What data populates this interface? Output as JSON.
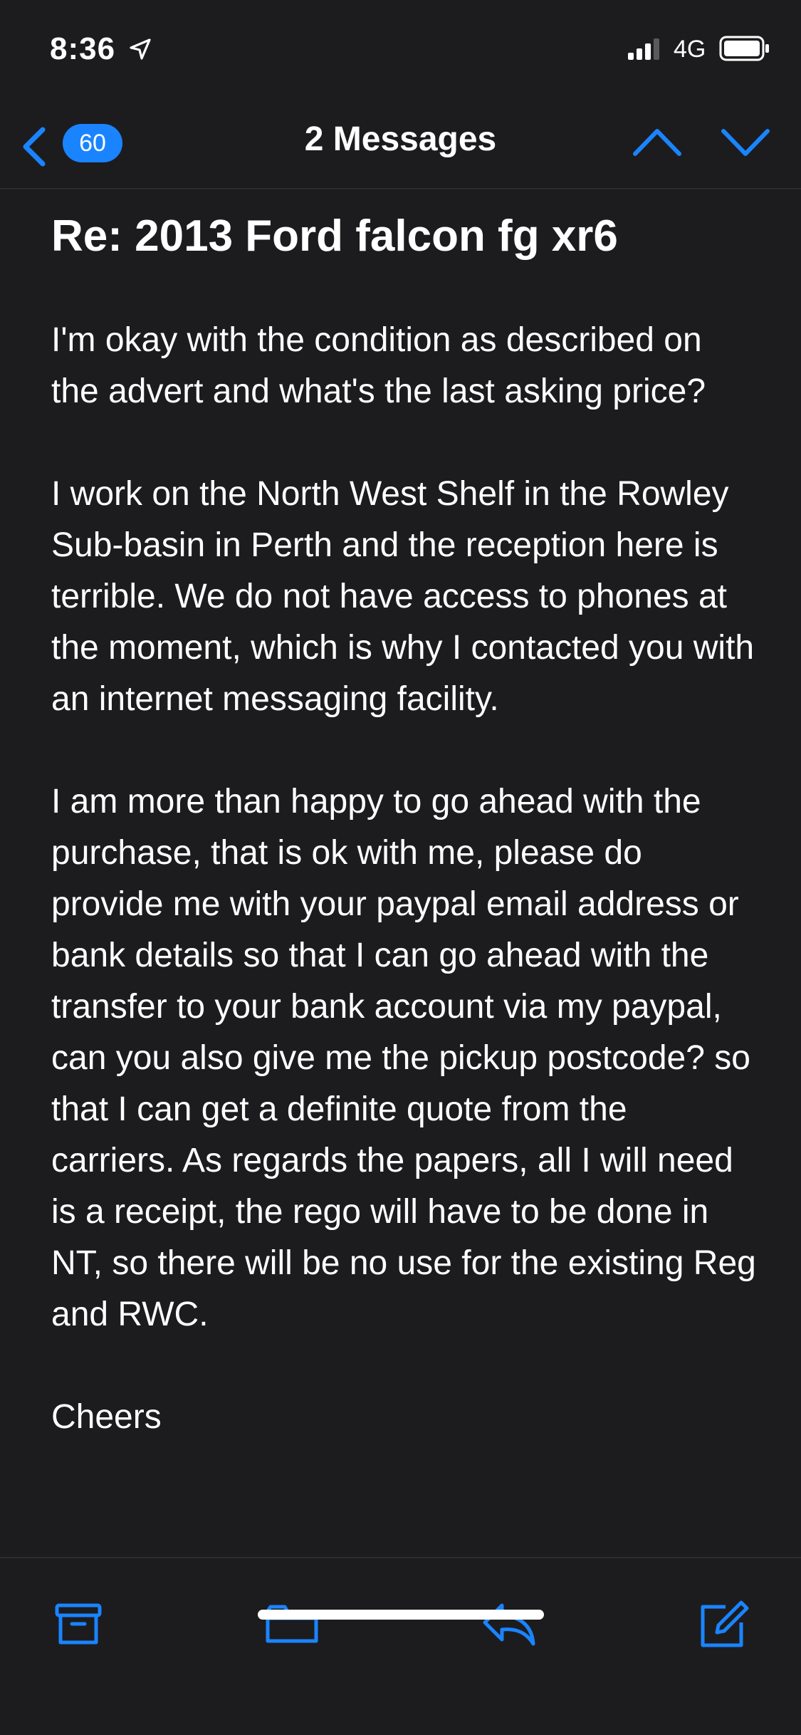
{
  "status_bar": {
    "time": "8:36",
    "network": "4G",
    "icons": [
      "location-arrow-icon",
      "signal-bars-icon",
      "battery-icon"
    ]
  },
  "nav": {
    "back_count": "60",
    "title": "2 Messages",
    "icons": [
      "back-chevron-icon",
      "chevron-up-icon",
      "chevron-down-icon"
    ]
  },
  "message": {
    "subject": "Re: 2013 Ford falcon fg xr6",
    "paragraphs": [
      "I'm okay with the condition as described on the advert and what's the last asking price?",
      "I work on the North West Shelf in the Rowley Sub-basin in Perth and the reception here is terrible. We do not have access to phones at the moment, which is why I contacted you with an internet messaging facility.",
      "I am more than happy to go ahead with the purchase, that is ok with me, please do provide me with your paypal email address or bank details so that I can go ahead with the transfer to your bank account via my paypal, can you also give me the pickup postcode? so that I can get a definite quote from the carriers. As regards the papers, all I will need is a receipt, the rego will have to be done in NT, so there will be no use for the existing Reg and RWC.",
      "Cheers"
    ]
  },
  "toolbar": {
    "icons": [
      "archive-icon",
      "folder-icon",
      "reply-icon",
      "compose-icon"
    ]
  },
  "colors": {
    "background": "#1c1c1e",
    "accent": "#1a84ff",
    "text": "#ffffff"
  }
}
